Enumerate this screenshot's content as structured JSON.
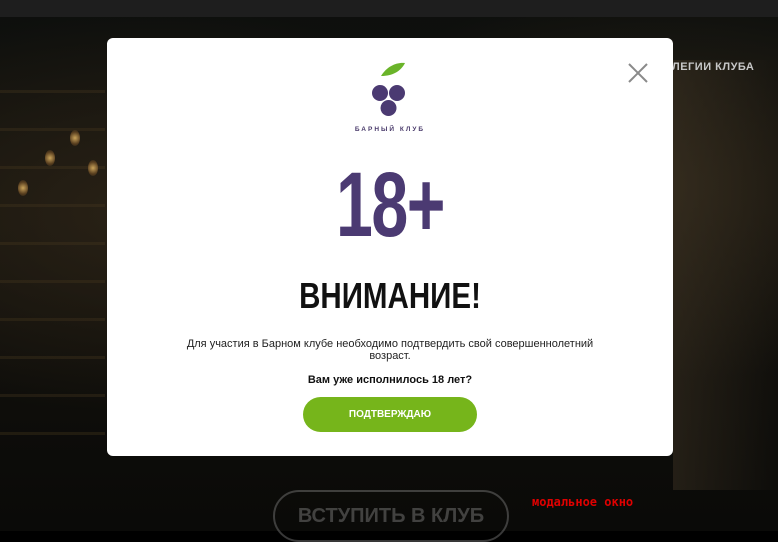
{
  "background": {
    "nav_partial": "ЛЕГИИ КЛУБА",
    "join_button_label": "ВСТУПИТЬ В КЛУБ"
  },
  "annotation": "модальное окно",
  "modal": {
    "close_icon": "close-icon",
    "logo_icon": "grape-logo-icon",
    "brand": "БАРНЫЙ КЛУБ",
    "age": "18+",
    "title": "ВНИМАНИЕ!",
    "description": "Для участия в Барном клубе необходимо подтвердить свой совершеннолетний возраст.",
    "question": "Вам уже исполнилось 18 лет?",
    "confirm_label": "ПОДТВЕРЖДАЮ"
  },
  "colors": {
    "accent_green": "#76b51b",
    "brand_purple": "#4b3a72",
    "leaf_green": "#6ab42a"
  }
}
